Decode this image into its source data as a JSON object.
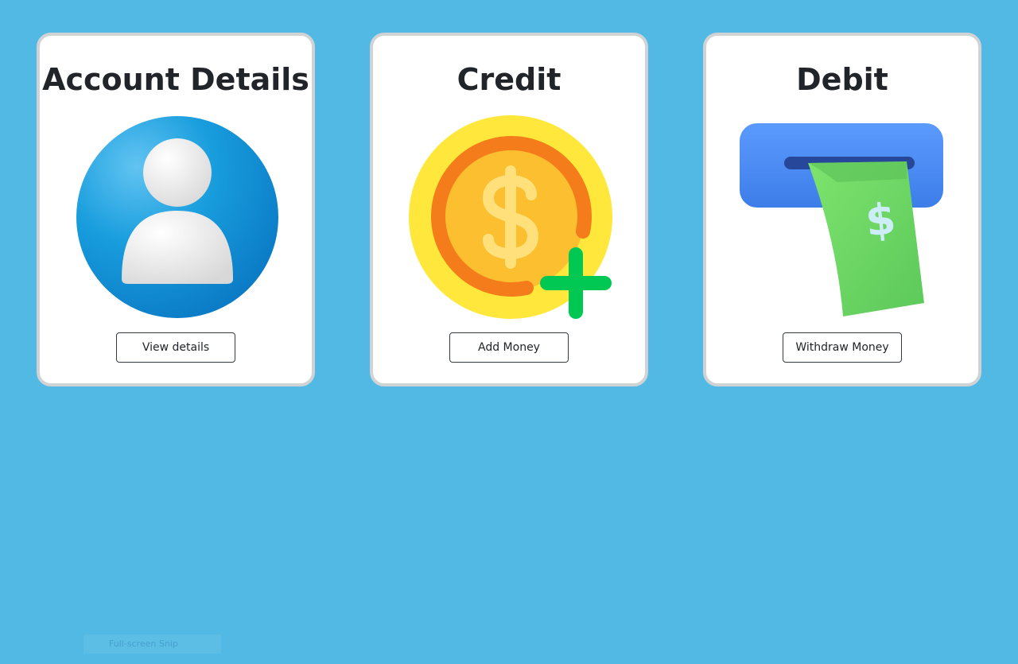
{
  "page": {
    "background_color": "#52b9e4"
  },
  "cards": [
    {
      "title": "Account Details",
      "button_label": "View details",
      "icon": "user-avatar-icon"
    },
    {
      "title": "Credit",
      "button_label": "Add Money",
      "icon": "coin-plus-icon"
    },
    {
      "title": "Debit",
      "button_label": "Withdraw Money",
      "icon": "cash-withdraw-icon"
    }
  ],
  "overlay": {
    "snip_label": "Full-screen Snip"
  },
  "colors": {
    "card_border": "#d0d3d6",
    "text": "#212529",
    "avatar_blue": "#1596db",
    "coin_yellow": "#ffe83b",
    "coin_orange": "#f57c1a",
    "plus_green": "#00c853",
    "atm_blue": "#4a8cf5",
    "bill_green": "#6dd86a"
  }
}
